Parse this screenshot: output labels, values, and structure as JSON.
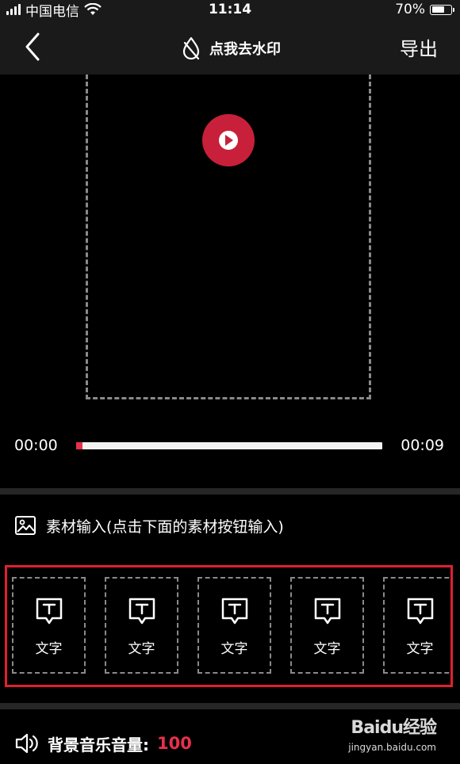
{
  "status": {
    "carrier": "中国电信",
    "time": "11:14",
    "battery": "70%",
    "battery_level": 0.7
  },
  "nav": {
    "title": "点我去水印",
    "export_label": "导出"
  },
  "player": {
    "current_time": "00:00",
    "total_time": "00:09",
    "progress": 0.02
  },
  "material": {
    "title": "素材输入(点击下面的素材按钮输入)",
    "items": [
      {
        "label": "文字"
      },
      {
        "label": "文字"
      },
      {
        "label": "文字"
      },
      {
        "label": "文字"
      },
      {
        "label": "文字"
      }
    ]
  },
  "volume": {
    "label": "背景音乐音量:",
    "value": "100"
  },
  "watermark": {
    "brand": "Baidu经验",
    "url": "jingyan.baidu.com"
  },
  "colors": {
    "accent": "#e8304c",
    "highlight_border": "#e02030",
    "play": "#c8203a"
  }
}
